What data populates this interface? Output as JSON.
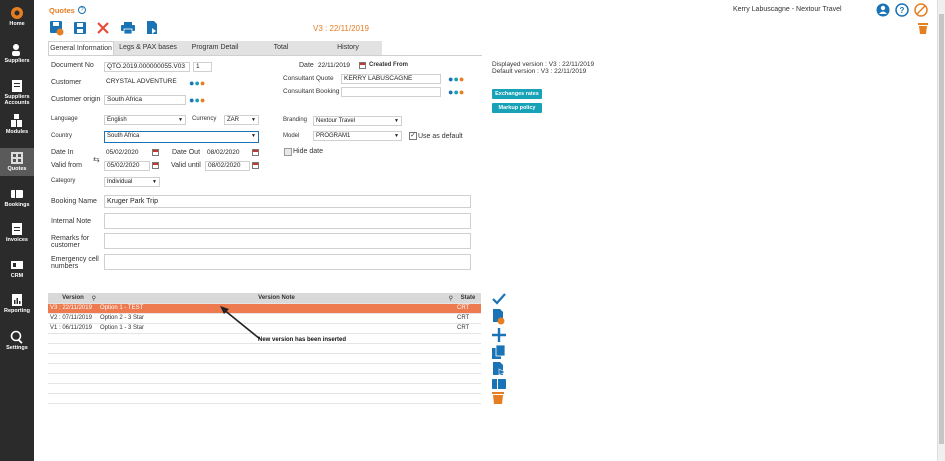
{
  "sidebar": {
    "items": [
      {
        "label": "Home",
        "icon": "home-icon"
      },
      {
        "label": "Suppliers",
        "icon": "suppliers-icon"
      },
      {
        "label": "Suppliers Accounts",
        "icon": "supplier-accounts-icon"
      },
      {
        "label": "Modules",
        "icon": "modules-icon"
      },
      {
        "label": "Quotes",
        "icon": "quotes-icon",
        "active": true
      },
      {
        "label": "Bookings",
        "icon": "bookings-icon"
      },
      {
        "label": "Invoices",
        "icon": "invoices-icon"
      },
      {
        "label": "CRM",
        "icon": "crm-icon"
      },
      {
        "label": "Reporting",
        "icon": "reporting-icon"
      },
      {
        "label": "Settings",
        "icon": "settings-icon"
      }
    ]
  },
  "header": {
    "title": "Quotes",
    "version_title": "V3 : 22/11/2019",
    "user": "Kerry Labuscagne - Nextour Travel"
  },
  "colors": {
    "accent": "#ee7b50",
    "sidebar": "#2b2b2b",
    "teal": "#17a2b8",
    "icon_blue": "#1a73b5",
    "icon_red": "#e74c3c"
  },
  "tabs": [
    "General Information",
    "Legs & PAX bases",
    "Program Detail",
    "Total",
    "History"
  ],
  "form": {
    "document_no_label": "Document No",
    "document_no": "QTO.2019.000000055.V03",
    "document_no_seq": "1",
    "date_label": "Date",
    "date": "22/11/2019",
    "created_from": "Created From",
    "customer_label": "Customer",
    "customer": "CRYSTAL ADVENTURE",
    "consultant_quote_label": "Consultant Quote",
    "consultant_quote": "KERRY LABUSCAGNE",
    "consultant_booking_label": "Consultant Booking",
    "consultant_booking": "",
    "customer_origin_label": "Customer origin",
    "customer_origin": "South Africa",
    "language_label": "Language",
    "language": "English",
    "currency_label": "Currency",
    "currency": "ZAR",
    "branding_label": "Branding",
    "branding": "Nextour Travel",
    "country_label": "Country",
    "country": "South Africa",
    "model_label": "Model",
    "model": "PROGRAM1",
    "use_default_label": "Use as default",
    "hide_date_label": "Hide date",
    "date_in_label": "Date In",
    "date_in": "05/02/2020",
    "date_out_label": "Date Out",
    "date_out": "08/02/2020",
    "valid_from_label": "Valid from",
    "valid_from": "05/02/2020",
    "valid_until_label": "Valid until",
    "valid_until": "08/02/2020",
    "category_label": "Category",
    "category": "Individual",
    "booking_name_label": "Booking Name",
    "booking_name": "Kruger Park Trip",
    "internal_note_label": "Internal Note",
    "remarks_label_1": "Remarks for",
    "remarks_label_2": "customer",
    "emergency_label_1": "Emergency cell",
    "emergency_label_2": "numbers"
  },
  "right_panel": {
    "displayed_version": "Displayed version : V3 : 22/11/2019",
    "default_version": "Default version : V3 : 22/11/2019",
    "exchanges_rates": "Exchanges rates",
    "markup_policy": "Markup policy"
  },
  "versions": {
    "headers": [
      "Version",
      "Version Note",
      "State"
    ],
    "rows": [
      {
        "version": "V3 : 22/11/2019",
        "note": "Option 1 - TEST",
        "state": "CRT"
      },
      {
        "version": "V2 : 07/11/2019",
        "note": "Option 2 - 3 Star",
        "state": "CRT"
      },
      {
        "version": "V1 : 06/11/2019",
        "note": "Option 1 - 3 Star",
        "state": "CRT"
      }
    ]
  },
  "annotation": "New version has been inserted"
}
